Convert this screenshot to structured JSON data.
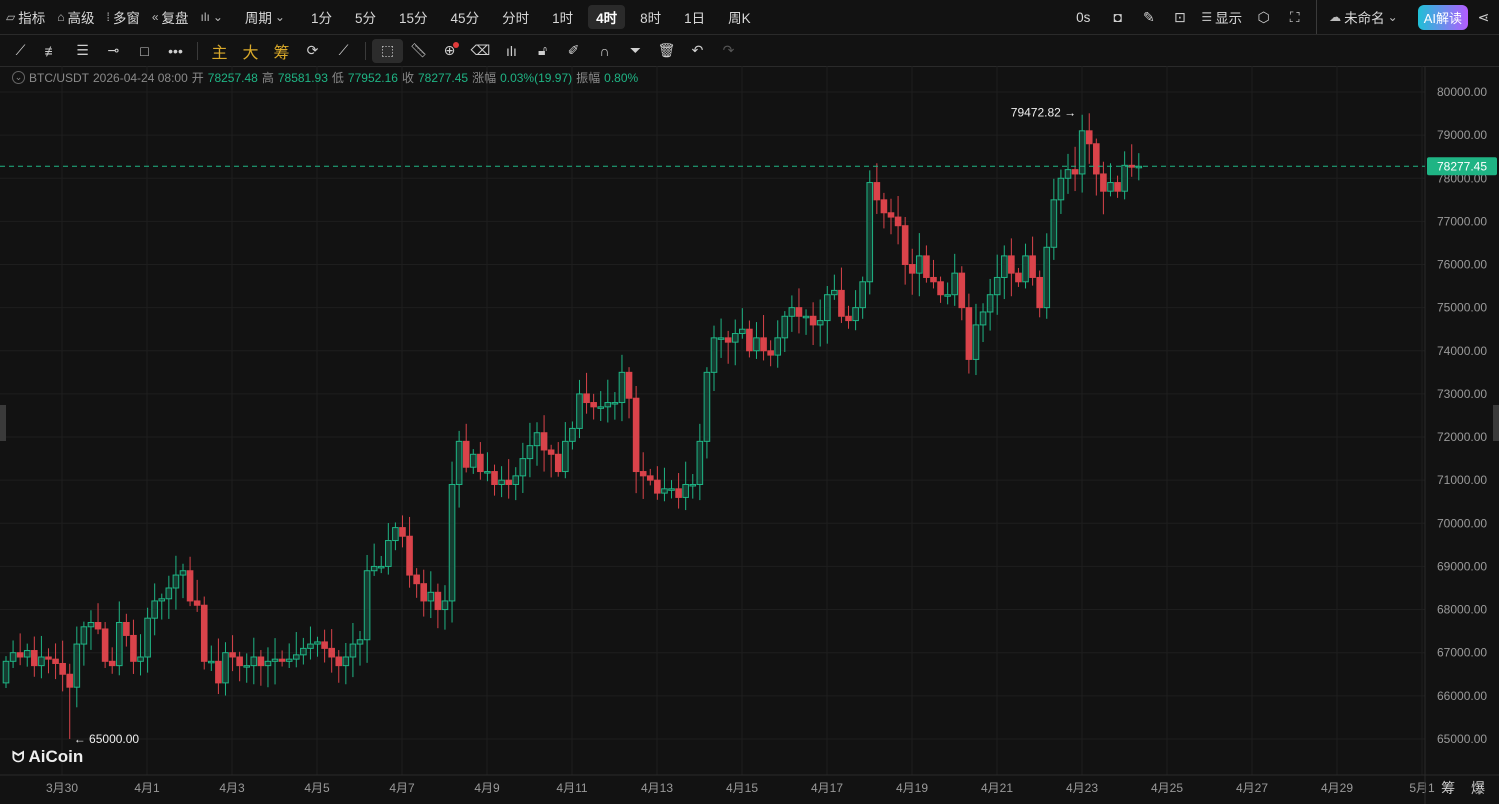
{
  "toolbar": {
    "indicators": "指标",
    "advanced": "高级",
    "multi_window": "多窗",
    "replay": "复盘",
    "period": "周期",
    "periods": [
      "1分",
      "5分",
      "15分",
      "45分",
      "分时",
      "1时",
      "4时",
      "8时",
      "1日",
      "周K"
    ],
    "active_period": "4时",
    "countdown": "0s",
    "display": "显示",
    "layout_name": "未命名",
    "ai_button": "AI解读"
  },
  "drawing_tools": {
    "main": "主",
    "big": "大",
    "chip": "筹"
  },
  "info": {
    "symbol": "BTC/USDT",
    "time": "2026-04-24 08:00",
    "open_label": "开",
    "open": "78257.48",
    "high_label": "高",
    "high": "78581.93",
    "low_label": "低",
    "low": "77952.16",
    "close_label": "收",
    "close": "78277.45",
    "change_label": "涨幅",
    "change": "0.03%(19.97)",
    "amp_label": "振幅",
    "amp": "0.80%"
  },
  "colors": {
    "up": "#1fb484",
    "down": "#d9434a",
    "bg": "#121212",
    "grid": "#1e1e1e"
  },
  "chart_data": {
    "type": "candlestick",
    "interval": "4h",
    "ylim": [
      64500,
      80500
    ],
    "y_ticks": [
      "80000.00",
      "79000.00",
      "78000.00",
      "77000.00",
      "76000.00",
      "75000.00",
      "74000.00",
      "73000.00",
      "72000.00",
      "71000.00",
      "70000.00",
      "69000.00",
      "68000.00",
      "67000.00",
      "66000.00",
      "65000.00"
    ],
    "x_ticks": [
      "3月30",
      "4月1",
      "4月3",
      "4月5",
      "4月7",
      "4月9",
      "4月11",
      "4月13",
      "4月15",
      "4月17",
      "4月19",
      "4月21",
      "4月23",
      "4月25",
      "4月27",
      "4月29",
      "5月1"
    ],
    "first_open": 66300,
    "closes": [
      66800,
      67000,
      66900,
      67050,
      66700,
      66900,
      66850,
      66750,
      66500,
      66200,
      67200,
      67600,
      67700,
      67550,
      66800,
      66700,
      67700,
      67400,
      66800,
      66900,
      67800,
      68200,
      68250,
      68500,
      68800,
      68900,
      68200,
      68100,
      66800,
      66800,
      66300,
      67000,
      66900,
      66700,
      66700,
      66900,
      66700,
      66800,
      66850,
      66800,
      66850,
      66950,
      67100,
      67200,
      67250,
      67100,
      66900,
      66700,
      66900,
      67200,
      67300,
      68900,
      69000,
      69000,
      69600,
      69900,
      69700,
      68800,
      68600,
      68200,
      68400,
      68000,
      68200,
      70900,
      71900,
      71300,
      71600,
      71200,
      71200,
      70900,
      71000,
      70900,
      71100,
      71500,
      71800,
      72100,
      71700,
      71600,
      71200,
      71900,
      72200,
      73000,
      72800,
      72700,
      72700,
      72800,
      72800,
      73500,
      72900,
      71200,
      71100,
      71000,
      70700,
      70800,
      70800,
      70600,
      70900,
      70900,
      71900,
      73500,
      74300,
      74300,
      74200,
      74400,
      74500,
      74000,
      74300,
      74000,
      73900,
      74300,
      74800,
      75000,
      74800,
      74800,
      74600,
      74700,
      75300,
      75400,
      74800,
      74700,
      75000,
      75600,
      77900,
      77500,
      77200,
      77100,
      76900,
      76000,
      75800,
      76200,
      75700,
      75600,
      75300,
      75300,
      75800,
      75000,
      73800,
      74600,
      74900,
      75300,
      75700,
      76200,
      75800,
      75600,
      76200,
      75700,
      75000,
      76400,
      77500,
      78000,
      78200,
      78100,
      79100,
      78800,
      78100,
      77700,
      77900,
      77700,
      78300,
      78257.48,
      78277.45
    ],
    "max_label": "79472.82",
    "max_value": 79472.82,
    "min_label": "65000.00",
    "min_value": 65000,
    "last_price": "78277.45",
    "last_value": 78277.45
  },
  "footer": {
    "right": "筹 爆"
  },
  "logo": "AiCoin"
}
